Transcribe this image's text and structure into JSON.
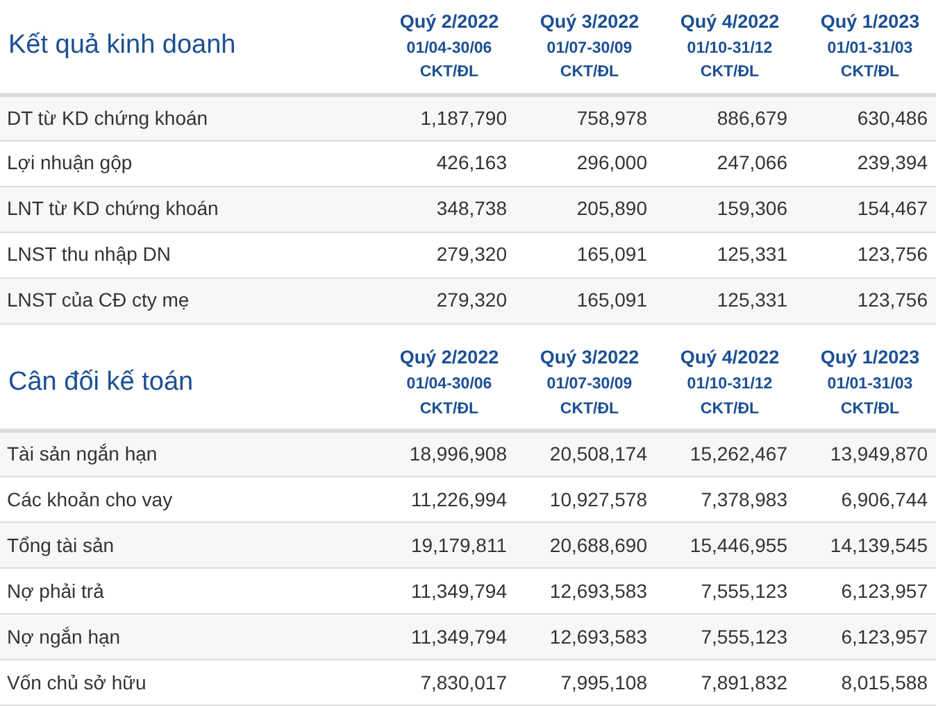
{
  "sections": [
    {
      "title": "Kết quả kinh doanh",
      "columns": [
        {
          "quarter": "Quý 2/2022",
          "period": "01/04-30/06",
          "standard": "CKT/ĐL"
        },
        {
          "quarter": "Quý 3/2022",
          "period": "01/07-30/09",
          "standard": "CKT/ĐL"
        },
        {
          "quarter": "Quý 4/2022",
          "period": "01/10-31/12",
          "standard": "CKT/ĐL"
        },
        {
          "quarter": "Quý 1/2023",
          "period": "01/01-31/03",
          "standard": "CKT/ĐL"
        }
      ],
      "rows": [
        {
          "label": "DT từ KD chứng khoán",
          "values": [
            "1,187,790",
            "758,978",
            "886,679",
            "630,486"
          ]
        },
        {
          "label": "Lợi nhuận gộp",
          "values": [
            "426,163",
            "296,000",
            "247,066",
            "239,394"
          ]
        },
        {
          "label": "LNT từ KD chứng khoán",
          "values": [
            "348,738",
            "205,890",
            "159,306",
            "154,467"
          ]
        },
        {
          "label": "LNST thu nhập DN",
          "values": [
            "279,320",
            "165,091",
            "125,331",
            "123,756"
          ]
        },
        {
          "label": "LNST của CĐ cty mẹ",
          "values": [
            "279,320",
            "165,091",
            "125,331",
            "123,756"
          ]
        }
      ]
    },
    {
      "title": "Cân đối kế toán",
      "columns": [
        {
          "quarter": "Quý 2/2022",
          "period": "01/04-30/06",
          "standard": "CKT/ĐL"
        },
        {
          "quarter": "Quý 3/2022",
          "period": "01/07-30/09",
          "standard": "CKT/ĐL"
        },
        {
          "quarter": "Quý 4/2022",
          "period": "01/10-31/12",
          "standard": "CKT/ĐL"
        },
        {
          "quarter": "Quý 1/2023",
          "period": "01/01-31/03",
          "standard": "CKT/ĐL"
        }
      ],
      "rows": [
        {
          "label": "Tài sản ngắn hạn",
          "values": [
            "18,996,908",
            "20,508,174",
            "15,262,467",
            "13,949,870"
          ]
        },
        {
          "label": "Các khoản cho vay",
          "values": [
            "11,226,994",
            "10,927,578",
            "7,378,983",
            "6,906,744"
          ]
        },
        {
          "label": "Tổng tài sản",
          "values": [
            "19,179,811",
            "20,688,690",
            "15,446,955",
            "14,139,545"
          ]
        },
        {
          "label": "Nợ phải trả",
          "values": [
            "11,349,794",
            "12,693,583",
            "7,555,123",
            "6,123,957"
          ]
        },
        {
          "label": "Nợ ngắn hạn",
          "values": [
            "11,349,794",
            "12,693,583",
            "7,555,123",
            "6,123,957"
          ]
        },
        {
          "label": "Vốn chủ sở hữu",
          "values": [
            "7,830,017",
            "7,995,108",
            "7,891,832",
            "8,015,588"
          ]
        }
      ]
    }
  ]
}
